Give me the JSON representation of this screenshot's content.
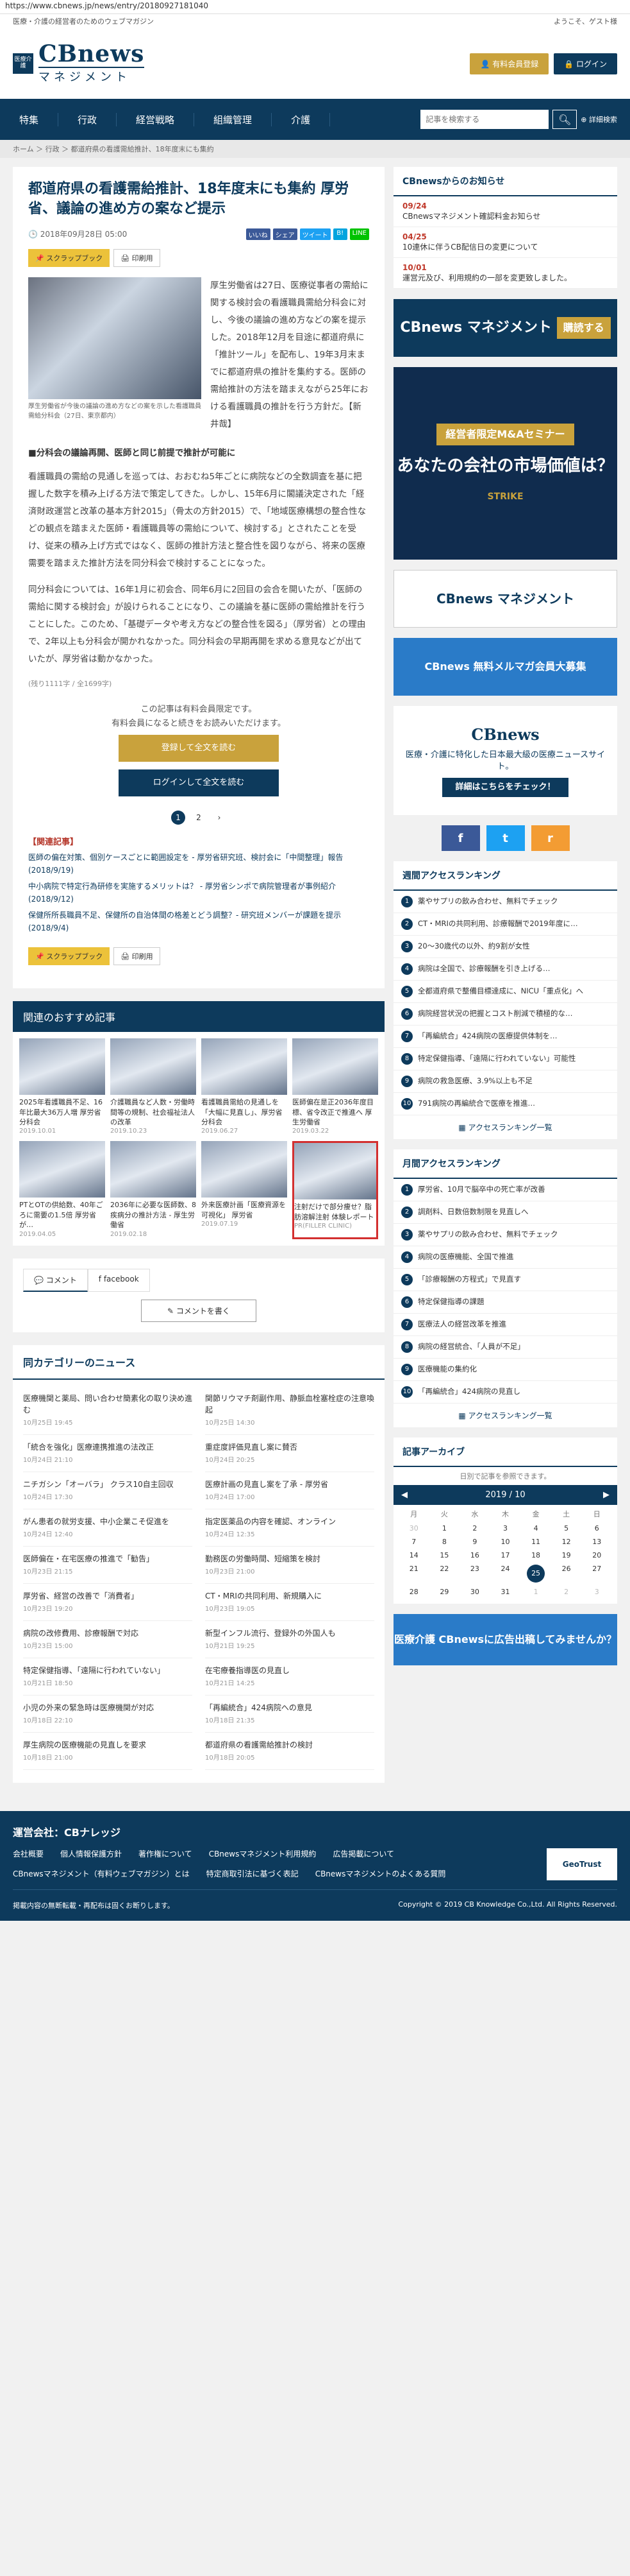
{
  "browser": {
    "url": "https://www.cbnews.jp/news/entry/20180927181040"
  },
  "top": {
    "tagline": "医療・介護の経営者のためのウェブマガジン",
    "welcome": "ようこそ、ゲスト様"
  },
  "logo": {
    "badge": "医療介護",
    "name": "CBnews",
    "sub": "マネジメント"
  },
  "header": {
    "register": "有料会員登録",
    "login": "ログイン"
  },
  "nav": {
    "items": [
      "特集",
      "行政",
      "経営戦略",
      "組織管理",
      "介護"
    ],
    "search_placeholder": "記事を検索する",
    "advanced": "詳細検索"
  },
  "breadcrumb": "ホーム ＞ 行政 ＞ 都道府県の看護需給推計、18年度末にも集約",
  "article": {
    "title": "都道府県の看護需給推計、18年度末にも集約 厚労省、議論の進め方の案など提示",
    "date": "2018年09月28日 05:00",
    "scrapbook": "スクラップブック",
    "print": "印刷用",
    "photo_caption": "厚生労働省が今後の議論の進め方などの案を示した看護職員需給分科会（27日、東京都内）",
    "p1": "厚生労働省は27日、医療従事者の需給に関する検討会の看護職員需給分科会に対し、今後の議論の進め方などの案を提示した。2018年12月を目途に都道府県に「推計ツール」を配布し、19年3月末までに都道府県の推計を集約する。医師の需給推計の方法を踏まえながら25年における看護職員の推計を行う方針だ。【新井哉】",
    "section": "■分科会の議論再開、医師と同じ前提で推計が可能に",
    "p2": "看護職員の需給の見通しを巡っては、おおむね5年ごとに病院などの全数調査を基に把握した数字を積み上げる方法で策定してきた。しかし、15年6月に閣議決定された「経済財政運営と改革の基本方針2015」（骨太の方針2015）で、「地域医療構想の整合性などの観点を踏まえた医師・看護職員等の需給について、検討する」とされたことを受け、従来の積み上げ方式ではなく、医師の推計方法と整合性を図りながら、将来の医療需要を踏まえた推計方法を同分科会で検討することになった。",
    "p3": "同分科会については、16年1月に初会合、同年6月に2回目の会合を開いたが、「医師の需給に関する検討会」が設けられることになり、この議論を基に医師の需給推計を行うことにした。このため、「基礎データや考え方などの整合性を図る」（厚労省）との理由で、2年以上も分科会が開かれなかった。同分科会の早期再開を求める意見などが出ていたが、厚労省は動かなかった。",
    "note": "(残り1111字 / 全1699字)"
  },
  "share": {
    "like": "いいね",
    "share": "シェア",
    "tweet": "ツイート",
    "bookmark": "B!",
    "line": "LINE"
  },
  "paywall": {
    "line1": "この記事は有料会員限定です。",
    "line2": "有料会員になると続きをお読みいただけます。",
    "register": "登録して全文を読む",
    "login": "ログインして全文を読む"
  },
  "pager": [
    "1",
    "2"
  ],
  "related": {
    "title": "【関連記事】",
    "items": [
      "医師の偏在対策、個別ケースごとに範囲設定を - 厚労省研究班、検討会に「中間整理」報告(2018/9/19)",
      "中小病院で特定行為研修を実施するメリットは？ - 厚労省シンポで病院管理者が事例紹介(2018/9/12)",
      "保健所所長職員不足、保健所の自治体間の格差とどう調整？- 研究班メンバーが課題を提示(2018/9/4)"
    ]
  },
  "recommended": {
    "title": "関連のおすすめ記事",
    "items": [
      {
        "t": "2025年看護職員不足、16年比最大36万人増 厚労省分科会",
        "d": "2019.10.01"
      },
      {
        "t": "介護職員など人数・労働時間等の規制、社会福祉法人の改革",
        "d": "2019.10.23"
      },
      {
        "t": "看護職員需給の見通しを「大幅に見直し」、厚労省分科会",
        "d": "2019.06.27"
      },
      {
        "t": "医師偏在是正2036年度目標、省令改正で推進へ 厚生労働省",
        "d": "2019.03.22"
      },
      {
        "t": "PTとOTの供給数、40年ごろに需要の1.5倍 厚労省が…",
        "d": "2019.04.05"
      },
      {
        "t": "2036年に必要な医師数、8疾病分の推計方法 - 厚生労働省",
        "d": "2019.02.18"
      },
      {
        "t": "外来医療計画「医療資源を可視化」 厚労省",
        "d": "2019.07.19"
      },
      {
        "t": "注射だけで部分痩せ？脂肪溶解注射 体験レポート",
        "d": "PR(FILLER CLINIC)"
      }
    ]
  },
  "comments": {
    "tab_comment": "コメント",
    "tab_facebook": "facebook",
    "write": "コメントを書く"
  },
  "category": {
    "title": "同カテゴリーのニュース",
    "items": [
      {
        "t": "医療機関と薬局、問い合わせ簡素化の取り決め進む",
        "d": "10月25日 19:45"
      },
      {
        "t": "関節リウマチ剤副作用、静脈血栓塞栓症の注意喚起",
        "d": "10月25日 14:30"
      },
      {
        "t": "「統合を強化」医療連携推進の法改正",
        "d": "10月24日 21:10"
      },
      {
        "t": "重症度評価見直し案に賛否",
        "d": "10月24日 20:25"
      },
      {
        "t": "ニチガシン「オーバラ」 クラス10自主回収",
        "d": "10月24日 17:30"
      },
      {
        "t": "医療計画の見直し案を了承 - 厚労省",
        "d": "10月24日 17:00"
      },
      {
        "t": "がん患者の就労支援、中小企業こそ促進を",
        "d": "10月24日 12:40"
      },
      {
        "t": "指定医薬品の内容を確認、オンライン",
        "d": "10月24日 12:35"
      },
      {
        "t": "医師偏在・在宅医療の推進で「勧告」",
        "d": "10月23日 21:15"
      },
      {
        "t": "勤務医の労働時間、短縮策を検討",
        "d": "10月23日 21:00"
      },
      {
        "t": "厚労省、経営の改善で「消費者」",
        "d": "10月23日 19:20"
      },
      {
        "t": "CT・MRIの共同利用、新規購入に",
        "d": "10月23日 19:05"
      },
      {
        "t": "病院の改修費用、診療報酬で対応",
        "d": "10月23日 15:00"
      },
      {
        "t": "新型インフル流行、登録外の外国人も",
        "d": "10月21日 19:25"
      },
      {
        "t": "特定保健指導、「遠隔に行われていない」",
        "d": "10月21日 18:50"
      },
      {
        "t": "在宅療養指導医の見直し",
        "d": "10月21日 14:25"
      },
      {
        "t": "小児の外来の緊急時は医療機関が対応",
        "d": "10月18日 22:10"
      },
      {
        "t": "「再編統合」424病院への意見",
        "d": "10月18日 21:35"
      },
      {
        "t": "厚生病院の医療機能の見直しを要求",
        "d": "10月18日 21:00"
      },
      {
        "t": "都道府県の看護需給推計の検討",
        "d": "10月18日 20:05"
      }
    ]
  },
  "sidebar": {
    "news_title": "CBnewsからのお知らせ",
    "news": [
      {
        "d": "09/24",
        "t": "CBnewsマネジメント確認料金お知らせ"
      },
      {
        "d": "04/25",
        "t": "10連休に伴うCB配信日の変更について"
      },
      {
        "d": "10/01",
        "t": "運営元及び、利用規約の一部を変更致しました。"
      }
    ],
    "ad_logo": "CBnews マネジメント",
    "ad_subscribe": "購読する",
    "ad_ma_title": "経営者限定M&Aセミナー",
    "ad_ma_body": "あなたの会社の市場価値は？",
    "ad_ma_sponsor": "STRIKE",
    "ad_banner": "CBnews マネジメント",
    "ad_magazine": "CBnews 無料メルマガ会員大募集",
    "ad_cb_title": "CBnews",
    "ad_cb_body": "医療・介護に特化した日本最大級の医療ニュースサイト。",
    "ad_cb_cta": "詳細はこちらをチェック！",
    "social": [
      "f",
      "t",
      "r"
    ],
    "weekly_title": "週間アクセスランキング",
    "weekly": [
      "薬やサプリの飲み合わせ、無料でチェック",
      "CT・MRIの共同利用、診療報酬で2019年度に…",
      "20～30歳代の以外、約9割が女性",
      "病院は全国で、診療報酬を引き上げる…",
      "全都道府県で整備目標達成に、NICU「重点化」へ",
      "病院経営状況の把握とコスト削減で積極的な…",
      "「再編統合」424病院の医療提供体制を…",
      "特定保健指導、「遠隔に行われていない」可能性",
      "病院の救急医療、3.9%以上も不足",
      "791病院の再編統合で医療を推進…"
    ],
    "weekly_more": "アクセスランキング一覧",
    "monthly_title": "月間アクセスランキング",
    "monthly": [
      "厚労省、10月で脳卒中の死亡率が改善",
      "調剤料、日数倍数制限を見直しへ",
      "薬やサプリの飲み合わせ、無料でチェック",
      "病院の医療機能、全国で推進",
      "「診療報酬の方程式」で見直す",
      "特定保健指導の課題",
      "医療法人の経営改革を推進",
      "病院の経営統合、「人員が不足」",
      "医療機能の集約化",
      "「再編統合」424病院の見直し"
    ],
    "monthly_more": "アクセスランキング一覧",
    "archive_title": "記事アーカイブ",
    "archive_sub": "日別で記事を参照できます。",
    "calendar_month": "2019 / 10",
    "calendar_dow": [
      "月",
      "火",
      "水",
      "木",
      "金",
      "土",
      "日"
    ],
    "calendar_days": [
      "30",
      "1",
      "2",
      "3",
      "4",
      "5",
      "6",
      "7",
      "8",
      "9",
      "10",
      "11",
      "12",
      "13",
      "14",
      "15",
      "16",
      "17",
      "18",
      "19",
      "20",
      "21",
      "22",
      "23",
      "24",
      "25",
      "26",
      "27",
      "28",
      "29",
      "30",
      "31",
      "1",
      "2",
      "3"
    ],
    "ad_bottom": "医療介護 CBnewsに広告出稿してみませんか？"
  },
  "footer": {
    "company": "運営会社：CBナレッジ",
    "links": [
      "会社概要",
      "個人情報保護方針",
      "著作権について",
      "CBnewsマネジメント利用規約",
      "広告掲載について",
      "CBnewsマネジメント（有料ウェブマガジン）とは",
      "特定商取引法に基づく表記",
      "CBnewsマネジメントのよくある質問"
    ],
    "note": "掲載内容の無断転載・再配布は固くお断りします。",
    "copyright": "Copyright © 2019 CB Knowledge Co.,Ltd. All Rights Reserved.",
    "geotrust": "GeoTrust"
  }
}
